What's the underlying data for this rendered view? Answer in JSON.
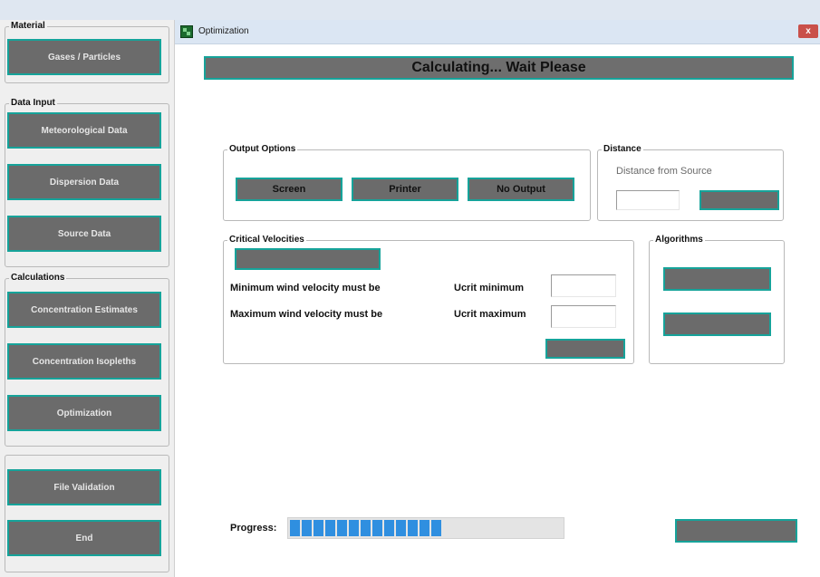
{
  "left_panel": {
    "material": {
      "legend": "Material",
      "buttons": [
        "Gases / Particles"
      ]
    },
    "data_input": {
      "legend": "Data Input",
      "buttons": [
        "Meteorological Data",
        "Dispersion Data",
        "Source Data"
      ]
    },
    "calculations": {
      "legend": "Calculations",
      "buttons": [
        "Concentration Estimates",
        "Concentration Isopleths",
        "Optimization"
      ]
    },
    "other": {
      "buttons": [
        "File Validation",
        "End"
      ]
    }
  },
  "window": {
    "title": "Optimization",
    "close_glyph": "x",
    "icon": "app-grid-icon"
  },
  "banner": "Calculating... Wait Please",
  "output_options": {
    "legend": "Output Options",
    "buttons": [
      "Screen",
      "Printer",
      "No Output"
    ]
  },
  "distance": {
    "legend": "Distance",
    "label": "Distance from Source",
    "input_value": "",
    "button_label": ""
  },
  "critical_velocities": {
    "legend": "Critical Velocities",
    "top_button_label": "",
    "min_label": "Minimum wind velocity must be",
    "max_label": "Maximum wind velocity must be",
    "ucrit_min_label": "Ucrit minimum",
    "ucrit_max_label": "Ucrit maximum",
    "ucrit_min_value": "",
    "ucrit_max_value": "",
    "apply_button_label": ""
  },
  "algorithms": {
    "legend": "Algorithms",
    "buttons": [
      "",
      ""
    ]
  },
  "progress": {
    "label": "Progress:",
    "value": 0.6,
    "segments_filled": 13
  },
  "bottom_button_label": "",
  "colors": {
    "button_fill": "#6b6b6b",
    "button_border": "#16a39a",
    "progress_fill": "#2f8fe0",
    "close_button": "#c9504a"
  }
}
